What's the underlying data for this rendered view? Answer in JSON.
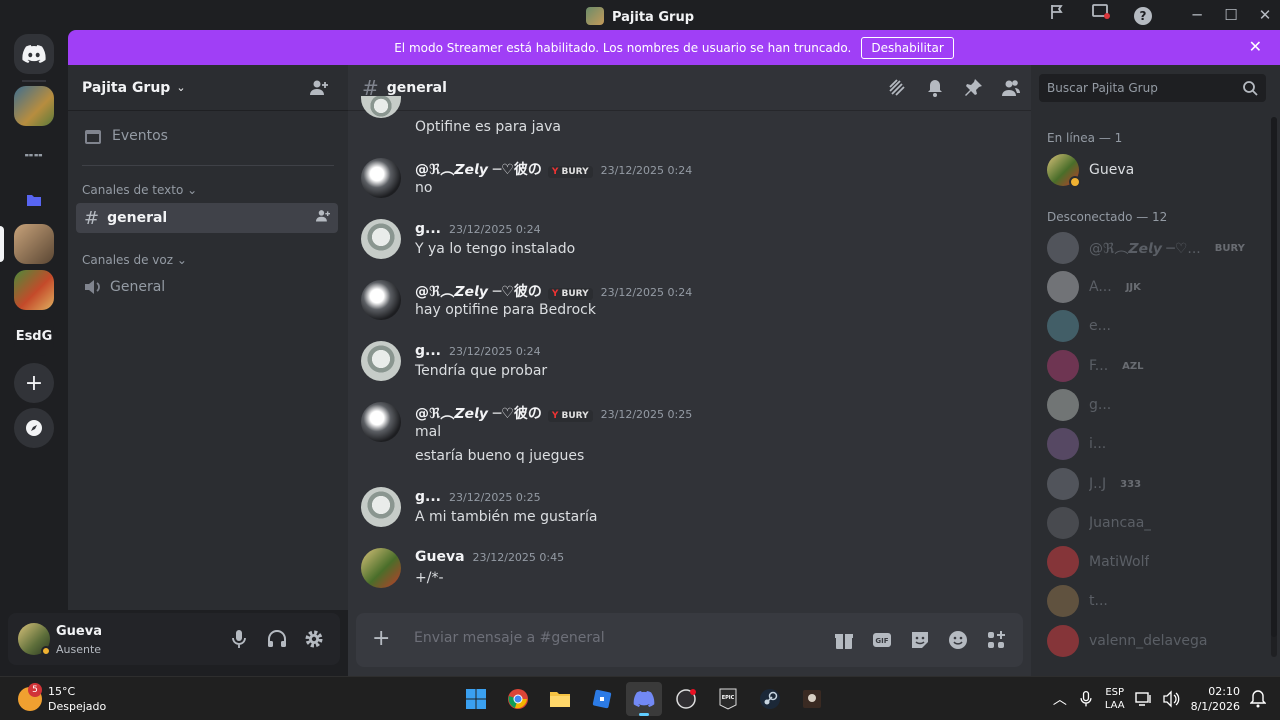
{
  "window": {
    "title": "Pajita Grup"
  },
  "rail": {
    "esdg_label": "EsdG"
  },
  "banner": {
    "text": "El modo Streamer está habilitado. Los nombres de usuario se han truncado.",
    "button": "Deshabilitar"
  },
  "server": {
    "name": "Pajita Grup",
    "events_label": "Eventos",
    "text_category": "Canales de texto",
    "voice_category": "Canales de voz",
    "text_channel": "general",
    "voice_channel": "General"
  },
  "user": {
    "name": "Gueva",
    "status": "Ausente"
  },
  "chat": {
    "channel": "general",
    "composer_placeholder": "Enviar mensaje a #general",
    "top_partial": "Optifine es para java",
    "messages": [
      {
        "author": "@ℜ︵𝙕𝙚𝙡𝙮 ─♡彼の",
        "badge": "BURY",
        "time": "23/12/2025 0:24",
        "lines": [
          "no"
        ]
      },
      {
        "author": "g...",
        "badge": "",
        "time": "23/12/2025 0:24",
        "lines": [
          "Y ya lo tengo instalado"
        ]
      },
      {
        "author": "@ℜ︵𝙕𝙚𝙡𝙮 ─♡彼の",
        "badge": "BURY",
        "time": "23/12/2025 0:24",
        "lines": [
          "hay optifine para Bedrock"
        ]
      },
      {
        "author": "g...",
        "badge": "",
        "time": "23/12/2025 0:24",
        "lines": [
          "Tendría que probar"
        ]
      },
      {
        "author": "@ℜ︵𝙕𝙚𝙡𝙮 ─♡彼の",
        "badge": "BURY",
        "time": "23/12/2025 0:25",
        "lines": [
          "mal",
          "estaría bueno q juegues"
        ]
      },
      {
        "author": "g...",
        "badge": "",
        "time": "23/12/2025 0:25",
        "lines": [
          "A mi también me gustaría"
        ]
      },
      {
        "author": "Gueva",
        "badge": "",
        "time": "23/12/2025 0:45",
        "lines": [
          "+/*-"
        ]
      }
    ]
  },
  "members": {
    "search_placeholder": "Buscar Pajita Grup",
    "online_header": "En línea — 1",
    "offline_header": "Desconectado — 12",
    "online": [
      {
        "name": "Gueva",
        "tag": ""
      }
    ],
    "offline": [
      {
        "name": "@ℜ︵𝙕𝙚𝙡𝙮 ─♡...",
        "tag": "BURY"
      },
      {
        "name": "A...",
        "tag": "JJK"
      },
      {
        "name": "e...",
        "tag": ""
      },
      {
        "name": "F...",
        "tag": "AZL"
      },
      {
        "name": "g...",
        "tag": ""
      },
      {
        "name": "i...",
        "tag": ""
      },
      {
        "name": "J..J",
        "tag": "333"
      },
      {
        "name": "Juancaa_",
        "tag": ""
      },
      {
        "name": "MatiWolf",
        "tag": ""
      },
      {
        "name": "t...",
        "tag": ""
      },
      {
        "name": "valenn_delavega",
        "tag": ""
      }
    ]
  },
  "taskbar": {
    "weather_badge": "5",
    "temperature": "15°C",
    "condition": "Despejado",
    "lang_top": "ESP",
    "lang_bottom": "LAA",
    "time": "02:10",
    "date": "8/1/2026"
  },
  "colors": {
    "accent": "#5865f2",
    "banner": "#a03ff6",
    "idle": "#f0b232"
  }
}
